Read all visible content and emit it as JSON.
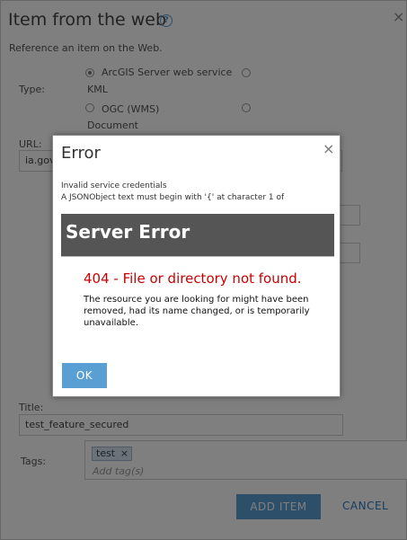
{
  "dialog": {
    "title": "Item from the web",
    "help_icon": "?",
    "close_icon": "×",
    "subtitle": "Reference an item on the Web.",
    "type_label": "Type:",
    "type_options": [
      {
        "label": "ArcGIS Server web service",
        "checked": true
      },
      {
        "label": "KML",
        "checked": false
      },
      {
        "label": "OGC (WMS)",
        "checked": false
      },
      {
        "label": "Document",
        "checked": false
      }
    ],
    "url_label": "URL:",
    "url_value": "ia.gov/",
    "title_label": "Title:",
    "title_value": "test_feature_secured",
    "tags_label": "Tags:",
    "tags": [
      "test"
    ],
    "tag_remove": "×",
    "tags_placeholder": "Add tag(s)",
    "add_button": "ADD ITEM",
    "cancel_button": "CANCEL"
  },
  "error_dialog": {
    "title": "Error",
    "close_icon": "×",
    "message_line1": "Invalid service credentials",
    "message_line2": "A JSONObject text must begin with '{' at character 1 of",
    "banner": "Server Error",
    "heading": "404 - File or directory not found.",
    "body": "The resource you are looking for might have been removed, had its name changed, or is temporarily unavailable.",
    "ok_button": "OK"
  },
  "colors": {
    "accent": "#5a9fd4",
    "error_red": "#cc0000",
    "banner_bg": "#555555"
  }
}
